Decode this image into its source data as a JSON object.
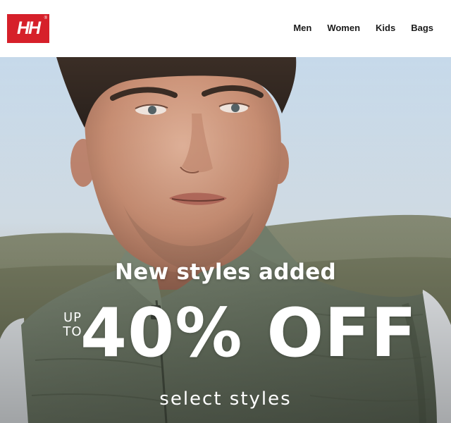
{
  "brand": {
    "logo_text": "HH",
    "logo_registered": "®",
    "logo_color": "#d6202a"
  },
  "nav": {
    "items": [
      "Men",
      "Women",
      "Kids",
      "Bags"
    ]
  },
  "hero": {
    "headline": "New styles added",
    "upto_line1": "UP",
    "upto_line2": "TO",
    "discount": "40% OFF",
    "subline": "select styles"
  }
}
